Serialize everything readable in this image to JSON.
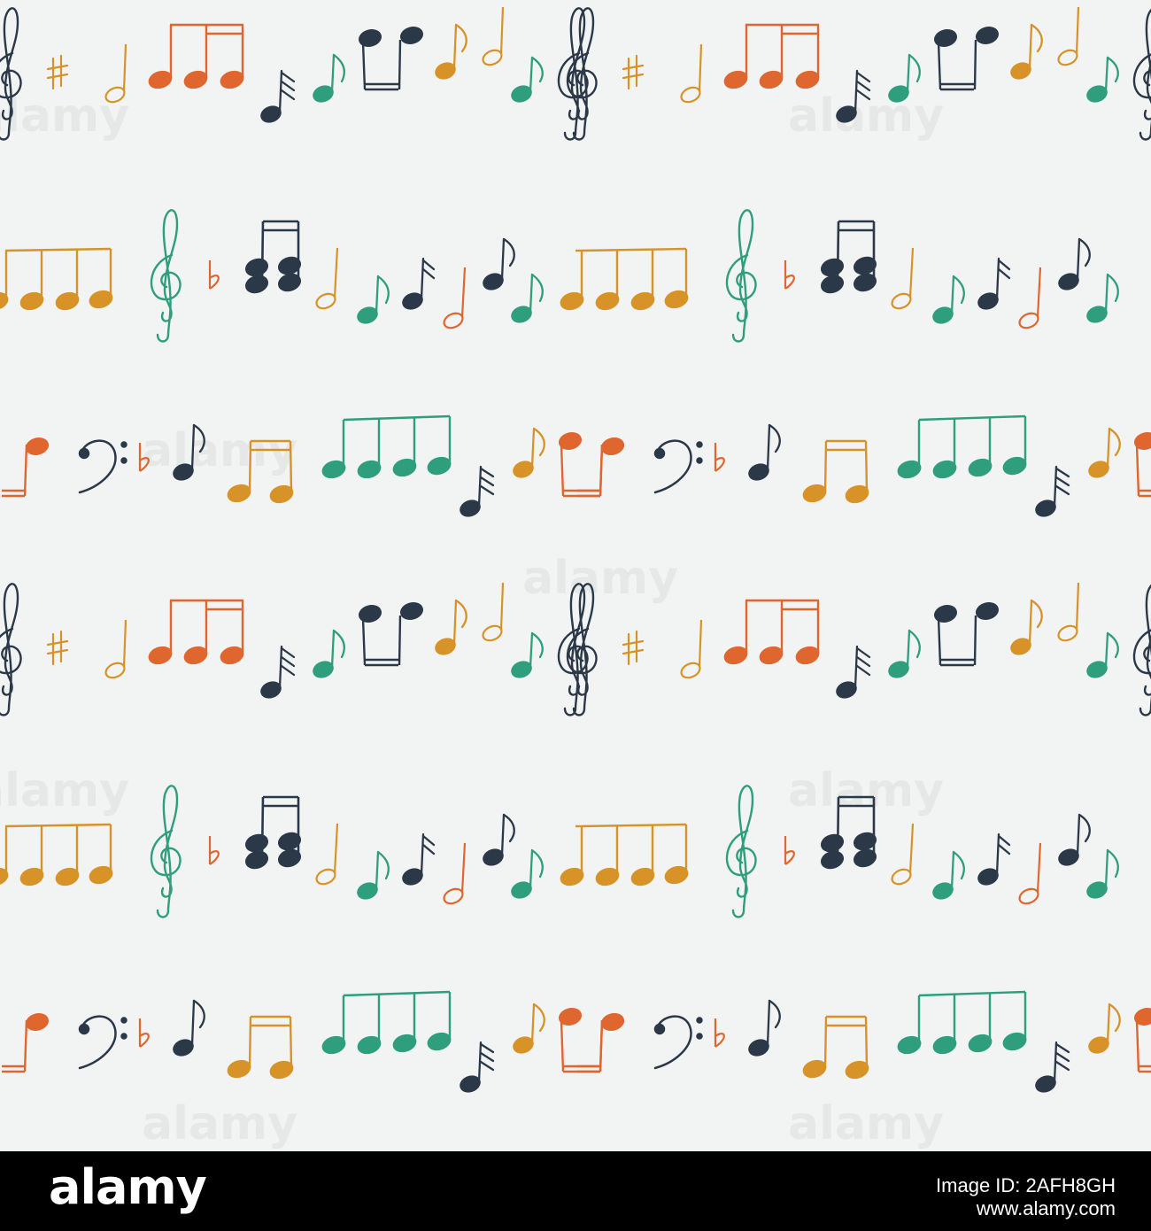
{
  "page": {
    "background_color": "#f2f4f4",
    "pattern": "hand-drawn music notes seamless pattern"
  },
  "palette": {
    "orange": "#e0662f",
    "mustard": "#d79327",
    "teal": "#2f9e7c",
    "navy": "#2b3848",
    "paper": "#f2f4f4"
  },
  "watermark": {
    "text": "alamy"
  },
  "footer": {
    "brand": "alamy",
    "image_id": "Image ID: 2AFH8GH",
    "url": "www.alamy.com",
    "background": "#000000"
  },
  "icons": [
    "treble-clef-icon",
    "bass-clef-icon",
    "sharp-icon",
    "flat-icon",
    "half-note-icon",
    "eighth-note-icon",
    "sixteenth-note-icon",
    "beamed-eighth-notes-icon",
    "beamed-sixteenth-notes-icon"
  ]
}
